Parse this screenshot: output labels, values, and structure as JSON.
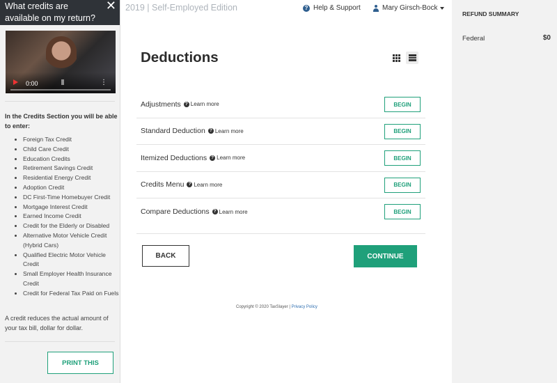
{
  "help_panel": {
    "title": "What credits are available on my return?",
    "video": {
      "time": "0:00"
    },
    "intro": "In the Credits Section you will be able to enter:",
    "credits": [
      "Foreign Tax Credit",
      "Child Care Credit",
      "Education Credits",
      "Retirement Savings Credit",
      "Residential Energy Credit",
      "Adoption Credit",
      "DC First-Time Homebuyer Credit",
      "Mortgage Interest Credit",
      "Earned Income Credit",
      "Credit for the Elderly or Disabled",
      "Alternative Motor Vehicle Credit (Hybrid Cars)",
      "Qualified Electric Motor Vehicle Credit",
      "Small Employer Health Insurance Credit",
      "Credit for Federal Tax Paid on Fuels"
    ],
    "note": "A credit reduces the actual amount of your tax bill, dollar for dollar.",
    "print_label": "PRINT THIS"
  },
  "header": {
    "edition": "2019 | Self-Employed Edition",
    "help_support": "Help & Support",
    "user_name": "Mary Girsch-Bock"
  },
  "main": {
    "title": "Deductions",
    "learn_more": "Learn more",
    "begin_label": "BEGIN",
    "rows": [
      {
        "name": "Adjustments"
      },
      {
        "name": "Standard Deduction"
      },
      {
        "name": "Itemized Deductions"
      },
      {
        "name": "Credits Menu"
      },
      {
        "name": "Compare Deductions"
      }
    ],
    "back_label": "BACK",
    "continue_label": "CONTINUE"
  },
  "footer": {
    "copyright": "Copyright © 2020 TaxSlayer |",
    "privacy": "Privacy Policy"
  },
  "refund": {
    "title": "REFUND SUMMARY",
    "federal_label": "Federal",
    "federal_value": "$0"
  },
  "colors": {
    "accent": "#1fa07a",
    "header_dark": "#2f3338",
    "panel_bg": "#f2f2f2"
  }
}
